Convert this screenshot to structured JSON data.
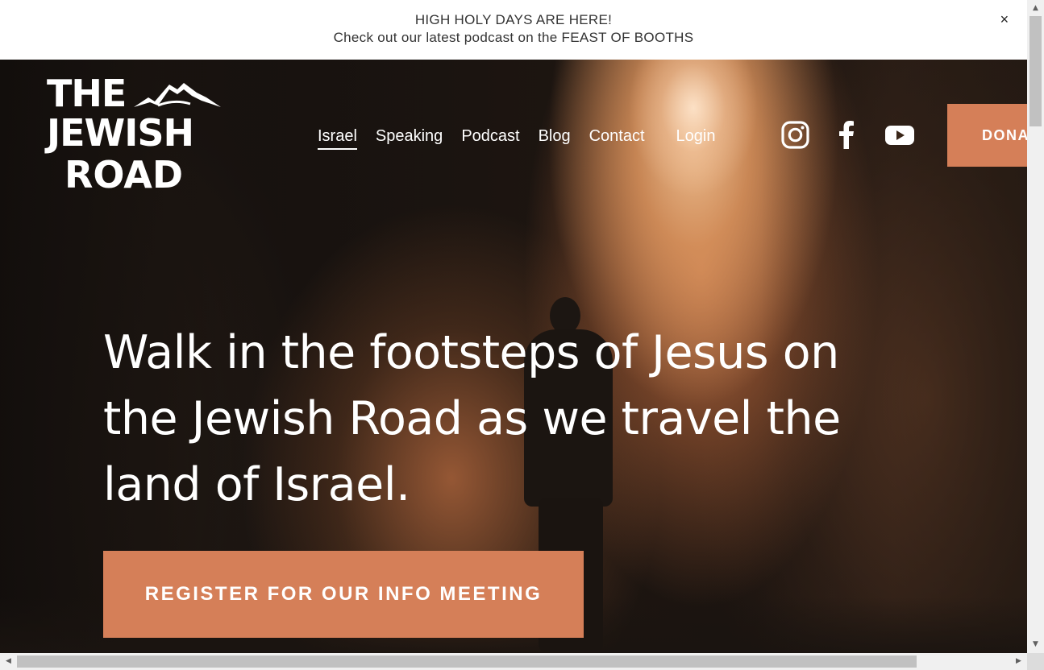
{
  "announcement": {
    "line1": "HIGH HOLY DAYS ARE HERE!",
    "line2": "Check out our latest podcast on the FEAST OF BOOTHS",
    "close_label": "×"
  },
  "logo": {
    "line1": "THE",
    "line2": "JEWISH",
    "line3": "ROAD"
  },
  "nav": {
    "items": [
      {
        "label": "Israel",
        "active": true
      },
      {
        "label": "Speaking"
      },
      {
        "label": "Podcast"
      },
      {
        "label": "Blog"
      },
      {
        "label": "Contact"
      }
    ],
    "login": "Login"
  },
  "social": {
    "icons": [
      "instagram-icon",
      "facebook-icon",
      "youtube-icon"
    ]
  },
  "donate": {
    "label": "DONATE"
  },
  "hero": {
    "headline": "Walk in the footsteps of Jesus on the Jewish Road as we travel the land of Israel.",
    "cta_label": "REGISTER FOR OUR INFO MEETING"
  },
  "colors": {
    "accent": "#d57f58",
    "text_light": "#ffffff",
    "announcement_bg": "#ffffff"
  },
  "scrollbars": {
    "up": "▲",
    "down": "▼",
    "left": "◀",
    "right": "▶"
  }
}
